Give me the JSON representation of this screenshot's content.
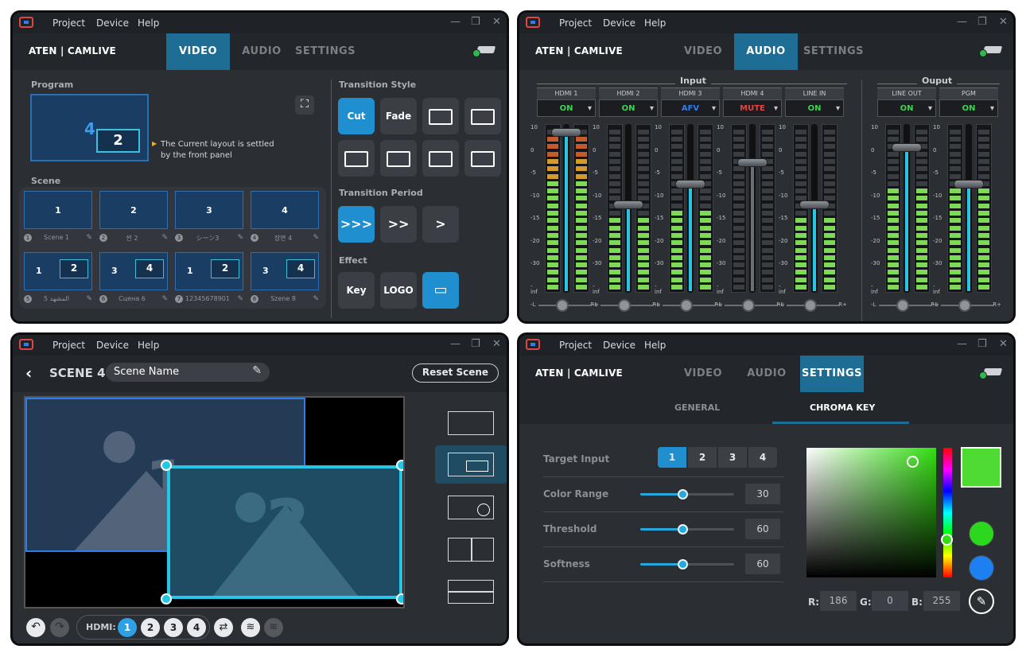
{
  "app": {
    "menu": [
      "Project",
      "Device",
      "Help"
    ],
    "brand": "ATEN | CAMLIVE",
    "tabs": [
      "VIDEO",
      "AUDIO",
      "SETTINGS"
    ]
  },
  "video": {
    "program_label": "Program",
    "program_main": "4",
    "program_pip": "2",
    "front_panel_note_1": "The Current layout is settled",
    "front_panel_note_2": "by the front panel",
    "scene_label": "Scene",
    "scenes": [
      {
        "idx": "1",
        "title": "Scene 1",
        "main": "1",
        "pip": ""
      },
      {
        "idx": "2",
        "title": "씬 2",
        "main": "2",
        "pip": ""
      },
      {
        "idx": "3",
        "title": "シーン3",
        "main": "3",
        "pip": ""
      },
      {
        "idx": "4",
        "title": "장면 4",
        "main": "4",
        "pip": ""
      },
      {
        "idx": "5",
        "title": "المشهد 5",
        "main": "1",
        "pip": "2"
      },
      {
        "idx": "6",
        "title": "Сцена 6",
        "main": "3",
        "pip": "4"
      },
      {
        "idx": "7",
        "title": "123456789012",
        "main": "1",
        "pip": "2"
      },
      {
        "idx": "8",
        "title": "Szene 8",
        "main": "3",
        "pip": "4"
      }
    ],
    "transition_style_label": "Transition Style",
    "transition_styles": [
      "Cut",
      "Fade"
    ],
    "transition_period_label": "Transition Period",
    "period_icons": [
      ">>>",
      ">>",
      ">"
    ],
    "effect_label": "Effect",
    "effects": [
      "Key",
      "LOGO"
    ]
  },
  "audio": {
    "input_label": "Input",
    "output_label": "Ouput",
    "channels": [
      {
        "name": "HDMI 1",
        "state": "ON",
        "color": "#3fd34f",
        "level": 0.96,
        "fader": 0.95
      },
      {
        "name": "HDMI 2",
        "state": "ON",
        "color": "#3fd34f",
        "level": 0.45,
        "fader": 0.52
      },
      {
        "name": "HDMI 3",
        "state": "AFV",
        "color": "#2e7df0",
        "level": 0.48,
        "fader": 0.64
      },
      {
        "name": "HDMI 4",
        "state": "MUTE",
        "color": "#e04545",
        "level": 0.0,
        "fader": 0.77
      },
      {
        "name": "LINE IN",
        "state": "ON",
        "color": "#3fd34f",
        "level": 0.45,
        "fader": 0.52
      }
    ],
    "outputs": [
      {
        "name": "LINE OUT",
        "state": "ON",
        "color": "#3fd34f",
        "level": 0.62,
        "fader": 0.86
      },
      {
        "name": "PGM",
        "state": "ON",
        "color": "#3fd34f",
        "level": 0.62,
        "fader": 0.64
      }
    ],
    "scale": [
      "10",
      "0",
      "-5",
      "-10",
      "-15",
      "-20",
      "-30",
      "-inf"
    ],
    "pan_left": "-L",
    "pan_right": "R+"
  },
  "scene_edit": {
    "title": "SCENE 4",
    "name_value": "Scene Name",
    "reset": "Reset Scene",
    "hdmi_label": "HDMI:",
    "hdmi_buttons": [
      "1",
      "2",
      "3",
      "4"
    ],
    "canvas_layer1": "1",
    "canvas_layer2": "2",
    "watermark": "HDMI"
  },
  "settings": {
    "subtabs": [
      "GENERAL",
      "CHROMA KEY"
    ],
    "target_input_label": "Target Input",
    "target_inputs": [
      "1",
      "2",
      "3",
      "4"
    ],
    "sliders": [
      {
        "label": "Color Range",
        "value": "30",
        "frac": 0.45
      },
      {
        "label": "Threshold",
        "value": "60",
        "frac": 0.45
      },
      {
        "label": "Softness",
        "value": "60",
        "frac": 0.45
      }
    ],
    "rgb": {
      "r_label": "R:",
      "r": "186",
      "g_label": "G:",
      "g": "0",
      "b_label": "B:",
      "b": "255"
    },
    "swatch_color": "#4fdb33",
    "preset_colors": [
      "#2bd81e",
      "#1e7ff0"
    ]
  }
}
